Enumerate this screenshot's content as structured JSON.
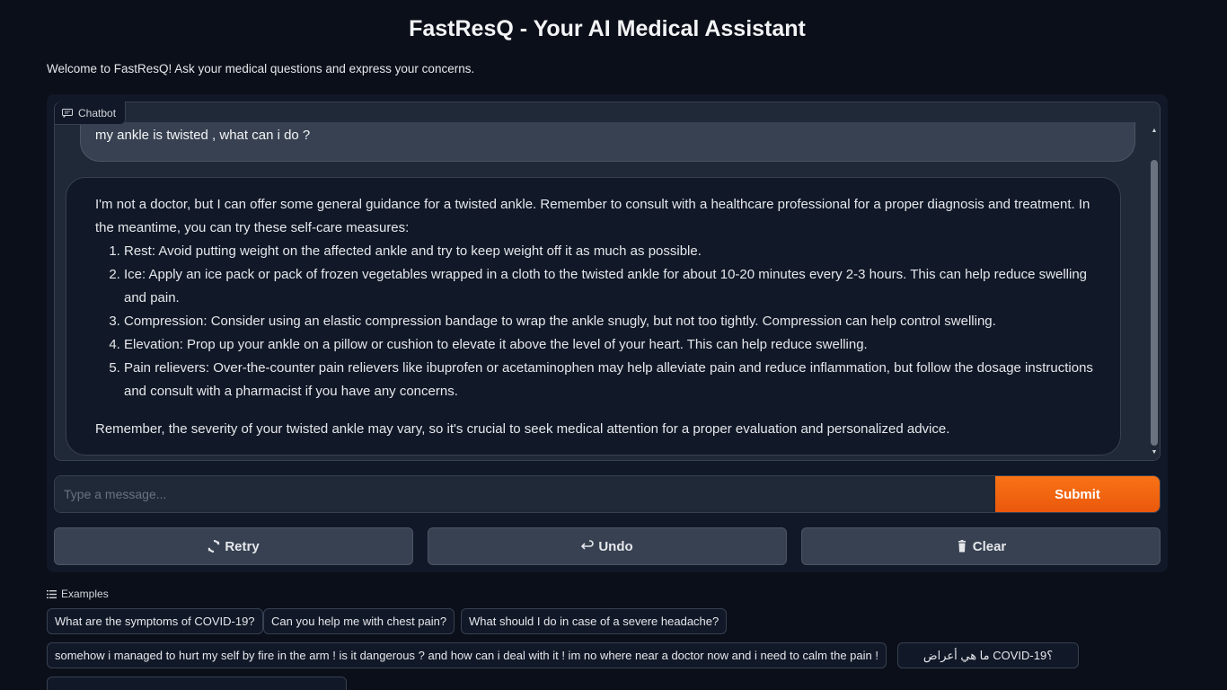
{
  "page": {
    "title": "FastResQ - Your AI Medical Assistant",
    "welcome": "Welcome to FastResQ! Ask your medical questions and express your concerns."
  },
  "chatbot": {
    "label": "Chatbot",
    "user_message": "my ankle is twisted , what can i do ?",
    "bot_intro": "I'm not a doctor, but I can offer some general guidance for a twisted ankle. Remember to consult with a healthcare professional for a proper diagnosis and treatment. In the meantime, you can try these self-care measures:",
    "bot_steps": [
      "Rest: Avoid putting weight on the affected ankle and try to keep weight off it as much as possible.",
      "Ice: Apply an ice pack or pack of frozen vegetables wrapped in a cloth to the twisted ankle for about 10-20 minutes every 2-3 hours. This can help reduce swelling and pain.",
      "Compression: Consider using an elastic compression bandage to wrap the ankle snugly, but not too tightly. Compression can help control swelling.",
      "Elevation: Prop up your ankle on a pillow or cushion to elevate it above the level of your heart. This can help reduce swelling.",
      "Pain relievers: Over-the-counter pain relievers like ibuprofen or acetaminophen may help alleviate pain and reduce inflammation, but follow the dosage instructions and consult with a pharmacist if you have any concerns."
    ],
    "bot_outro": "Remember, the severity of your twisted ankle may vary, so it's crucial to seek medical attention for a proper evaluation and personalized advice."
  },
  "input": {
    "placeholder": "Type a message...",
    "value": "",
    "submit_label": "Submit"
  },
  "actions": {
    "retry_label": "Retry",
    "undo_label": "Undo",
    "clear_label": "Clear"
  },
  "examples": {
    "label": "Examples",
    "items": [
      "What are the symptoms of COVID-19?",
      "Can you help me with chest pain?",
      "What should I do in case of a severe headache?",
      "somehow i managed to hurt my self by fire in the arm ! is it dangerous ? and how can i deal with it ! im no where near a doctor now and i need to calm the pain !",
      "ما هي أعراض COVID-19؟"
    ]
  },
  "colors": {
    "background": "#0b0f19",
    "panel": "#111827",
    "accent": "#f97316"
  }
}
